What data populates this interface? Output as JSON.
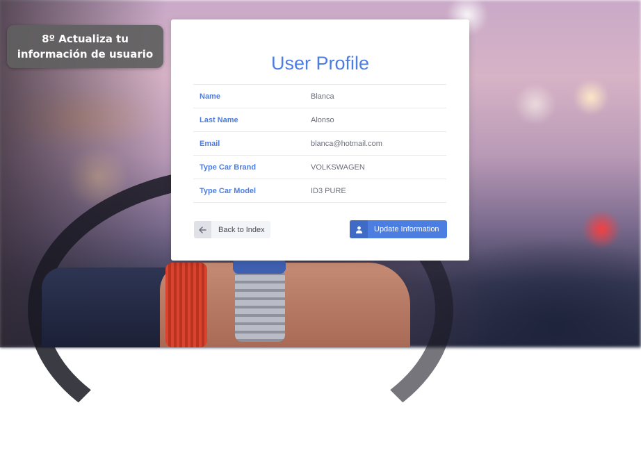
{
  "badge": {
    "line1": "8º Actualiza tu",
    "line2": "información de usuario"
  },
  "card": {
    "title": "User Profile",
    "rows": [
      {
        "label": "Name",
        "value": "Blanca"
      },
      {
        "label": "Last Name",
        "value": "Alonso"
      },
      {
        "label": "Email",
        "value": "blanca@hotmail.com"
      },
      {
        "label": "Type Car Brand",
        "value": "VOLKSWAGEN"
      },
      {
        "label": "Type Car Model",
        "value": "ID3 PURE"
      }
    ],
    "back_button": {
      "label": "Back to Index",
      "icon": "arrow-left-icon"
    },
    "update_button": {
      "label": "Update Information",
      "icon": "user-icon"
    }
  },
  "colors": {
    "accent": "#4c7de0",
    "badge_bg": "#5f5f5f"
  }
}
